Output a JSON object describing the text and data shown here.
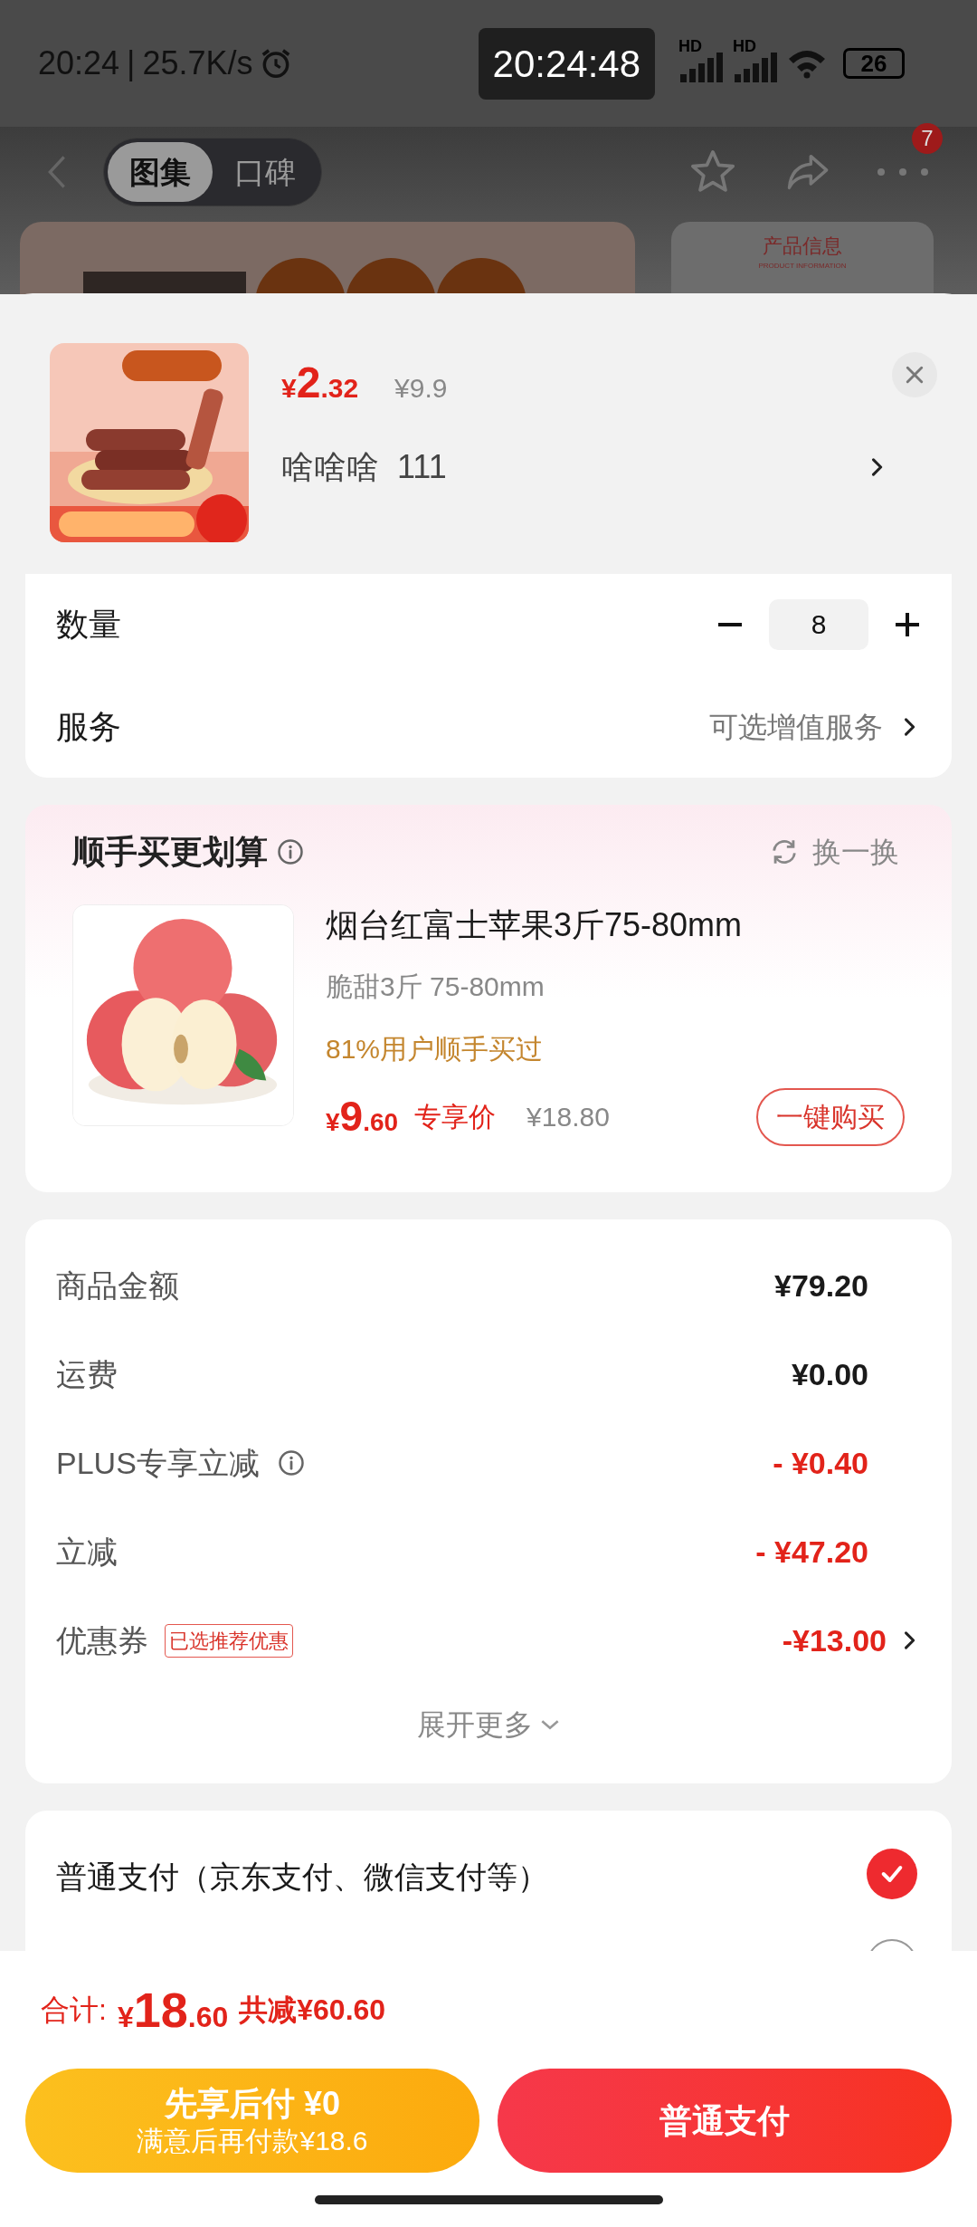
{
  "status_bar": {
    "time": "20:24",
    "separator": "|",
    "network_speed": "25.7K/s",
    "clock": "20:24:48",
    "signal_labels": [
      "HD",
      "HD"
    ],
    "battery": "26"
  },
  "nav": {
    "tabs": [
      {
        "label": "图集",
        "selected": true
      },
      {
        "label": "口碑",
        "selected": false
      }
    ],
    "badge": "7"
  },
  "background": {
    "info_title": "产品信息",
    "info_subtitle": "PRODUCT INFORMATION"
  },
  "product": {
    "price": {
      "symbol": "¥",
      "integer": "2",
      "decimal": ".32"
    },
    "original_price": "¥9.9",
    "spec": "啥啥啥  111"
  },
  "options": [
    {
      "kind": "stepper",
      "label": "数量",
      "value": "8"
    },
    {
      "kind": "link",
      "label": "服务",
      "value": "可选增值服务"
    }
  ],
  "addon": {
    "title": "顺手买更划算",
    "refresh": "换一换",
    "name": "烟台红富士苹果3斤75-80mm",
    "subtitle": "脆甜3斤 75-80mm",
    "social": "81%用户顺手买过",
    "price": {
      "symbol": "¥",
      "integer": "9",
      "decimal": ".60"
    },
    "price_label": "专享价",
    "original_price": "¥18.80",
    "button": "一键购买"
  },
  "summary": {
    "rows": [
      {
        "kind": "plain",
        "label": "商品金额",
        "value": "¥79.20",
        "info": false,
        "link": false
      },
      {
        "kind": "plain",
        "label": "运费",
        "value": "¥0.00",
        "info": false,
        "link": false
      },
      {
        "kind": "discount",
        "label": "PLUS专享立减",
        "value": "- ¥0.40",
        "info": true,
        "link": false
      },
      {
        "kind": "discount",
        "label": "立减",
        "value": "- ¥47.20",
        "info": false,
        "link": false
      },
      {
        "kind": "discount",
        "label": "优惠券",
        "tag": "已选推荐优惠",
        "value": "-¥13.00",
        "info": false,
        "link": true
      }
    ],
    "expand": "展开更多"
  },
  "payment_options": [
    {
      "label": "普通支付（京东支付、微信支付等）",
      "selected": true
    },
    {
      "selected": false
    }
  ],
  "footer": {
    "total_label": "合计:",
    "total": {
      "symbol": "¥",
      "integer": "18",
      "decimal": ".60"
    },
    "saved": "共减¥60.60",
    "later_pay": {
      "title": "先享后付 ¥0",
      "subtitle": "满意后再付款¥18.6"
    },
    "pay_button": "普通支付"
  }
}
